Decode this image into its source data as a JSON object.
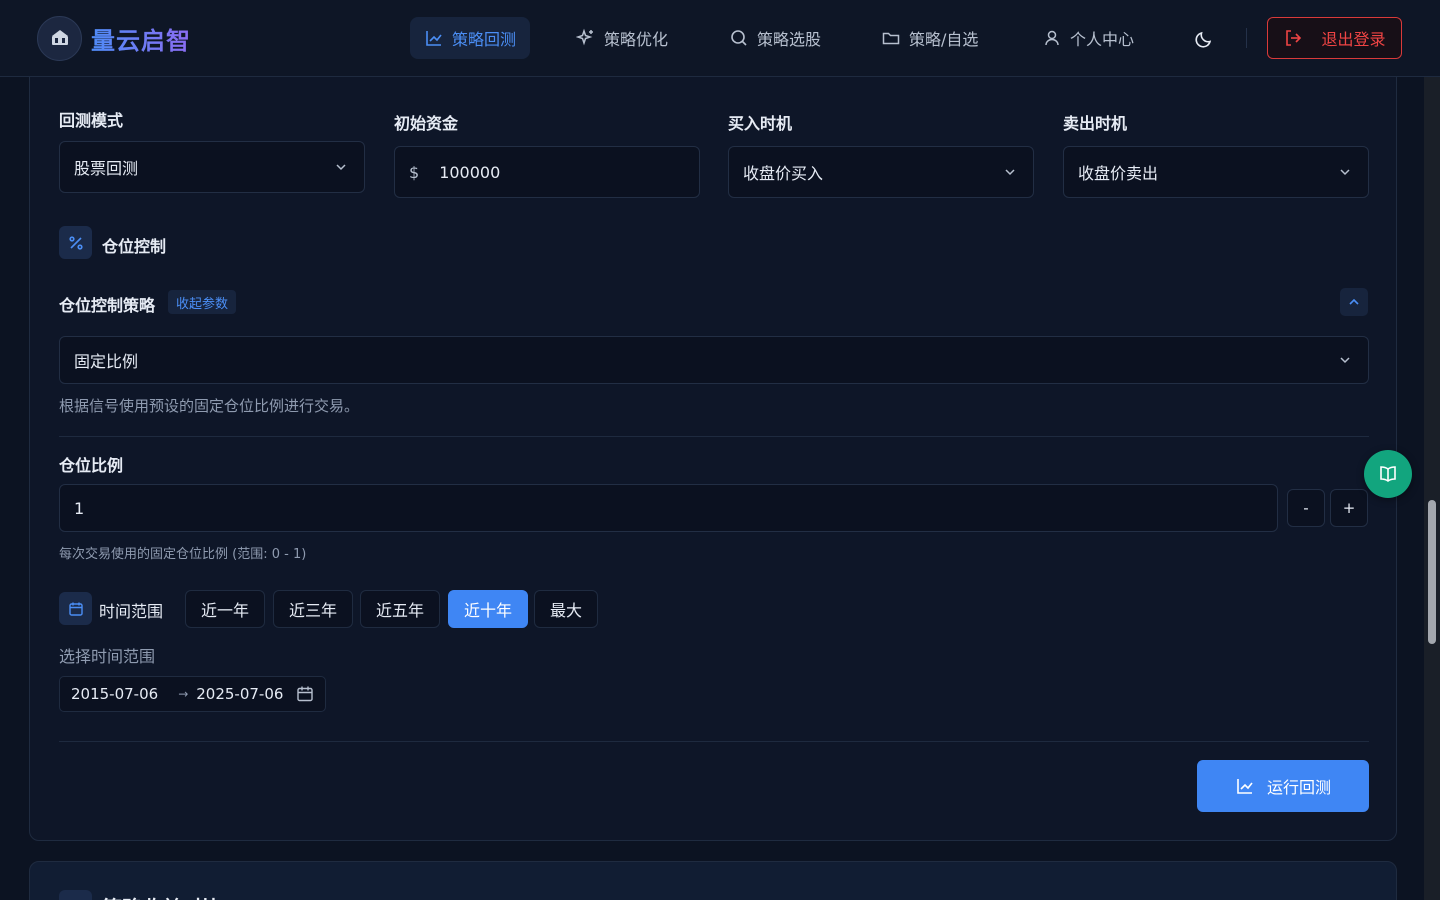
{
  "brand": {
    "name": "量云启智"
  },
  "nav": {
    "items": [
      {
        "label": "策略回测",
        "icon": "chart-line-icon",
        "active": true
      },
      {
        "label": "策略优化",
        "icon": "sparkles-icon",
        "active": false
      },
      {
        "label": "策略选股",
        "icon": "search-icon",
        "active": false
      },
      {
        "label": "策略/自选",
        "icon": "folder-icon",
        "active": false
      },
      {
        "label": "个人中心",
        "icon": "user-icon",
        "active": false
      }
    ],
    "theme_icon": "moon-icon",
    "logout_label": "退出登录"
  },
  "form": {
    "mode": {
      "label": "回测模式",
      "value": "股票回测"
    },
    "capital": {
      "label": "初始资金",
      "prefix": "$",
      "value": "100000"
    },
    "buy_timing": {
      "label": "买入时机",
      "value": "收盘价买入"
    },
    "sell_timing": {
      "label": "卖出时机",
      "value": "收盘价卖出"
    }
  },
  "position": {
    "section_title": "仓位控制",
    "strategy_label": "仓位控制策略",
    "collapse_tag": "收起参数",
    "strategy_value": "固定比例",
    "strategy_desc": "根据信号使用预设的固定仓位比例进行交易。",
    "ratio_label": "仓位比例",
    "ratio_value": "1",
    "minus": "-",
    "plus": "+",
    "ratio_desc": "每次交易使用的固定仓位比例 (范围: 0 - 1)"
  },
  "time_range": {
    "title": "时间范围",
    "presets": [
      "近一年",
      "近三年",
      "近五年",
      "近十年",
      "最大"
    ],
    "active_preset": "近十年",
    "select_label": "选择时间范围",
    "start": "2015-07-06",
    "separator": "→",
    "end": "2025-07-06"
  },
  "run_button": {
    "label": "运行回测"
  },
  "next_section": {
    "title": "策略收益对比"
  },
  "colors": {
    "accent": "#3f86f4",
    "danger": "#ef4444",
    "float": "#12a57e"
  }
}
